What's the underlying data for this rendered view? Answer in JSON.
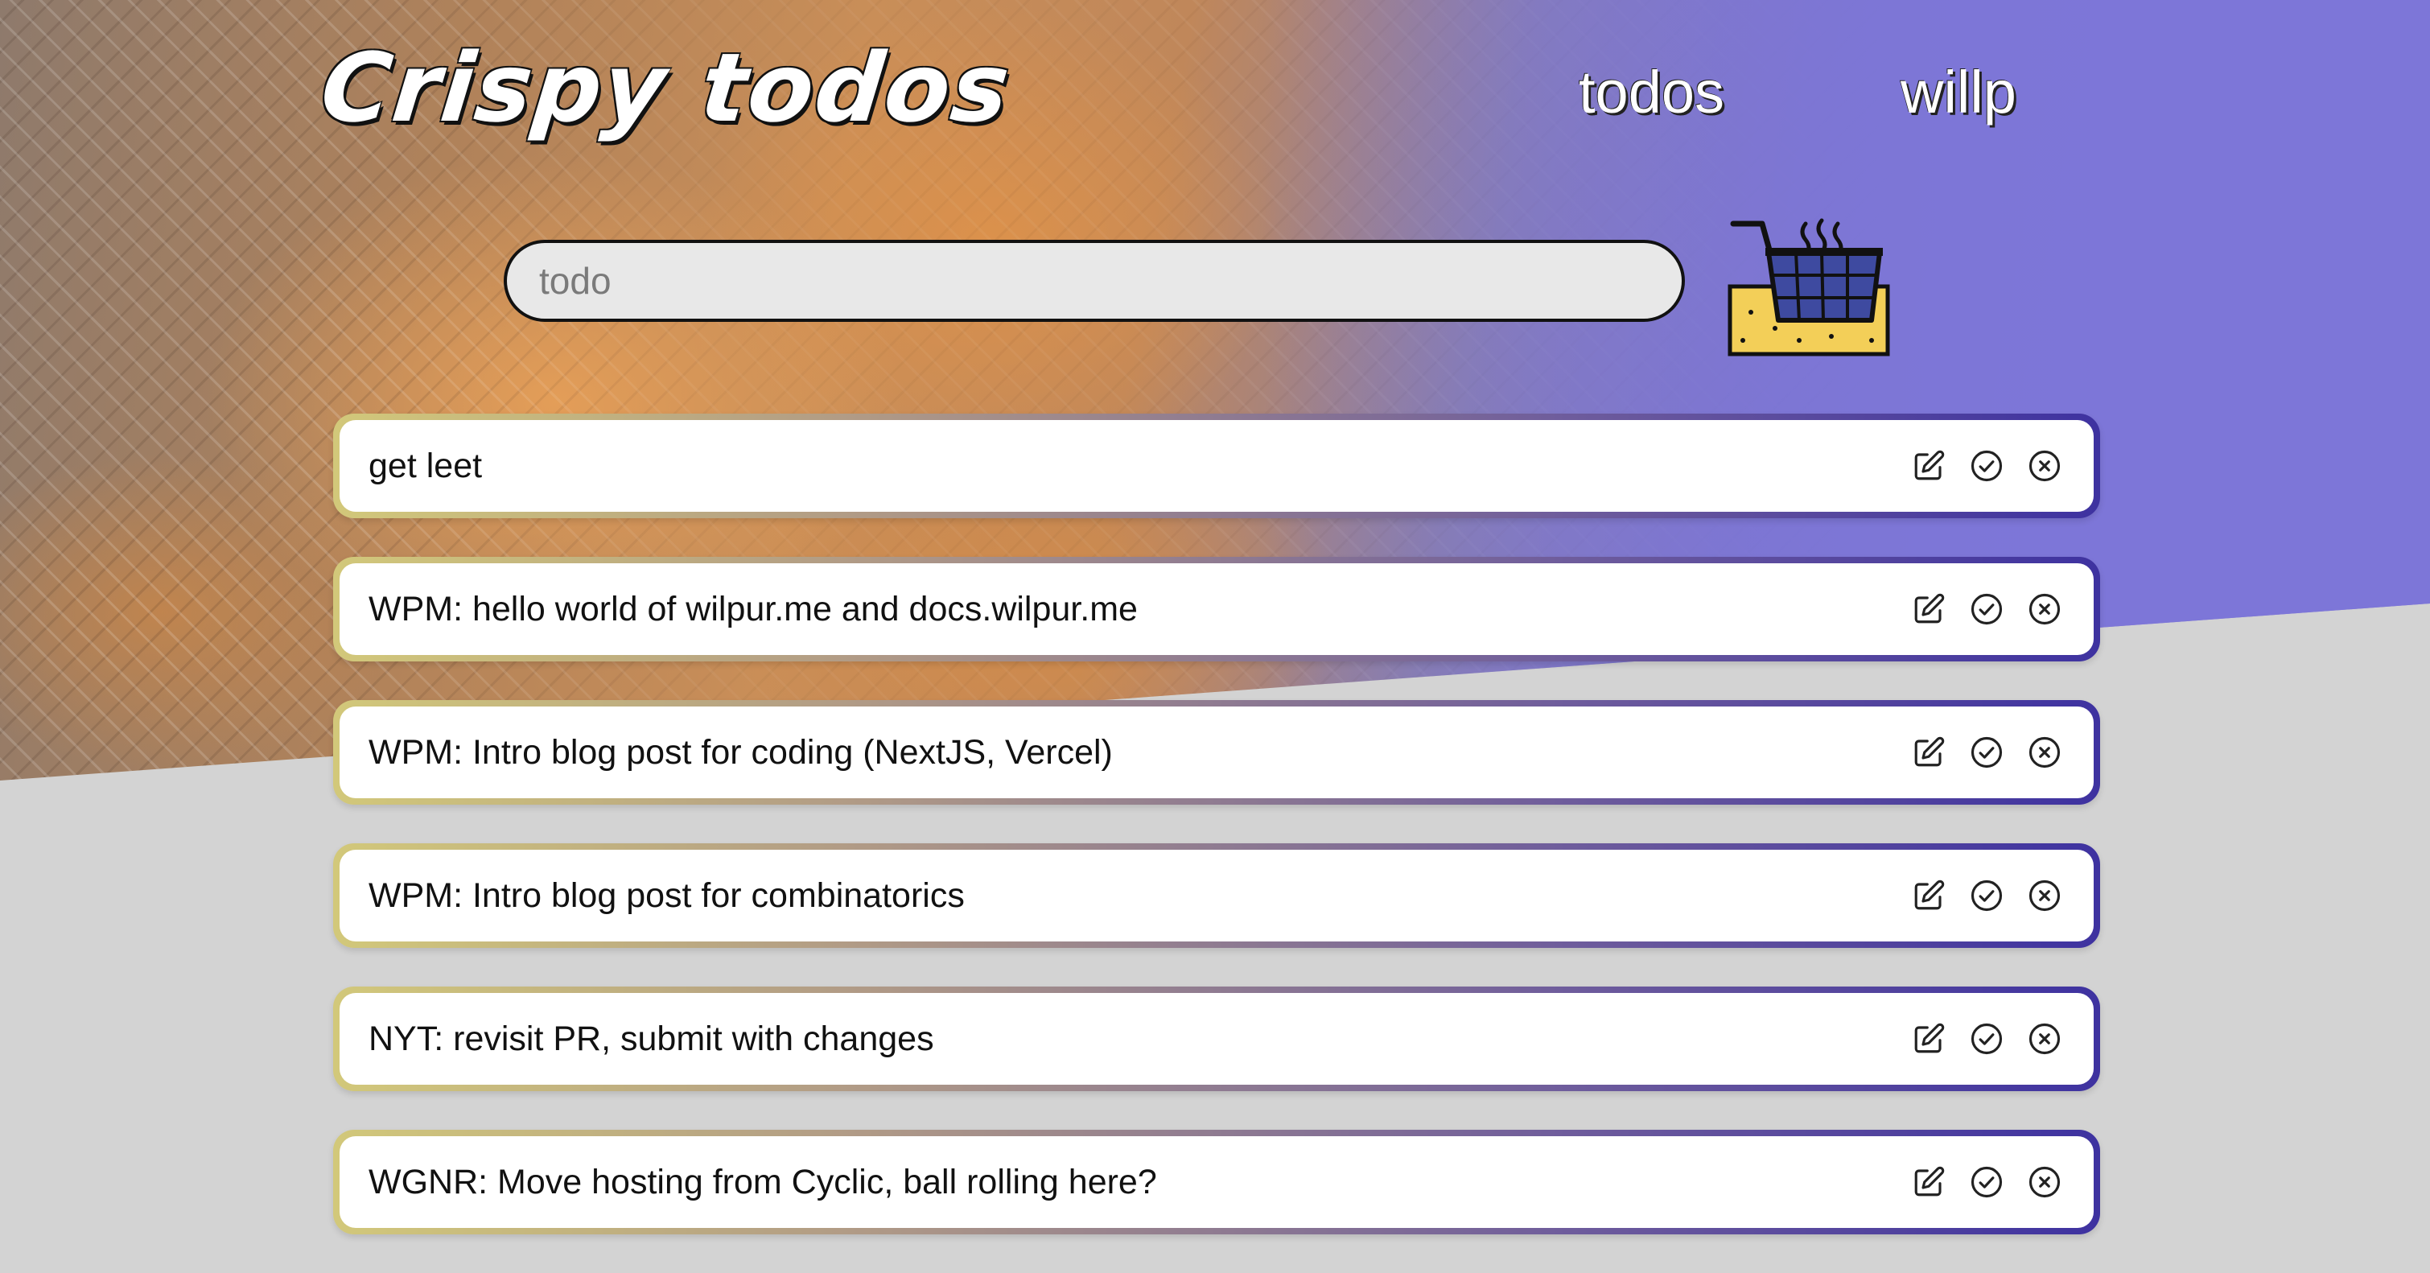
{
  "app": {
    "title": "Crispy todos"
  },
  "nav": {
    "todos_label": "todos",
    "user_label": "willp"
  },
  "new_todo": {
    "value": "",
    "placeholder": "todo",
    "submit_icon": "fryer-basket-icon"
  },
  "todos": [
    {
      "text": "get leet"
    },
    {
      "text": "WPM: hello world of wilpur.me and docs.wilpur.me"
    },
    {
      "text": "WPM: Intro blog post for coding (NextJS, Vercel)"
    },
    {
      "text": "WPM: Intro blog post for combinatorics"
    },
    {
      "text": "NYT: revisit PR, submit with changes"
    },
    {
      "text": "WGNR: Move hosting from Cyclic, ball rolling here?"
    }
  ],
  "todo_actions": [
    "edit-icon",
    "check-circle-icon",
    "close-circle-icon"
  ],
  "colors": {
    "page_background": "#d3d3d3",
    "accent_purple": "#7d77d6",
    "card_gradient_start": "#d2c87a",
    "card_gradient_end": "#3e32a0",
    "nugget_orange": "#f0a040"
  }
}
